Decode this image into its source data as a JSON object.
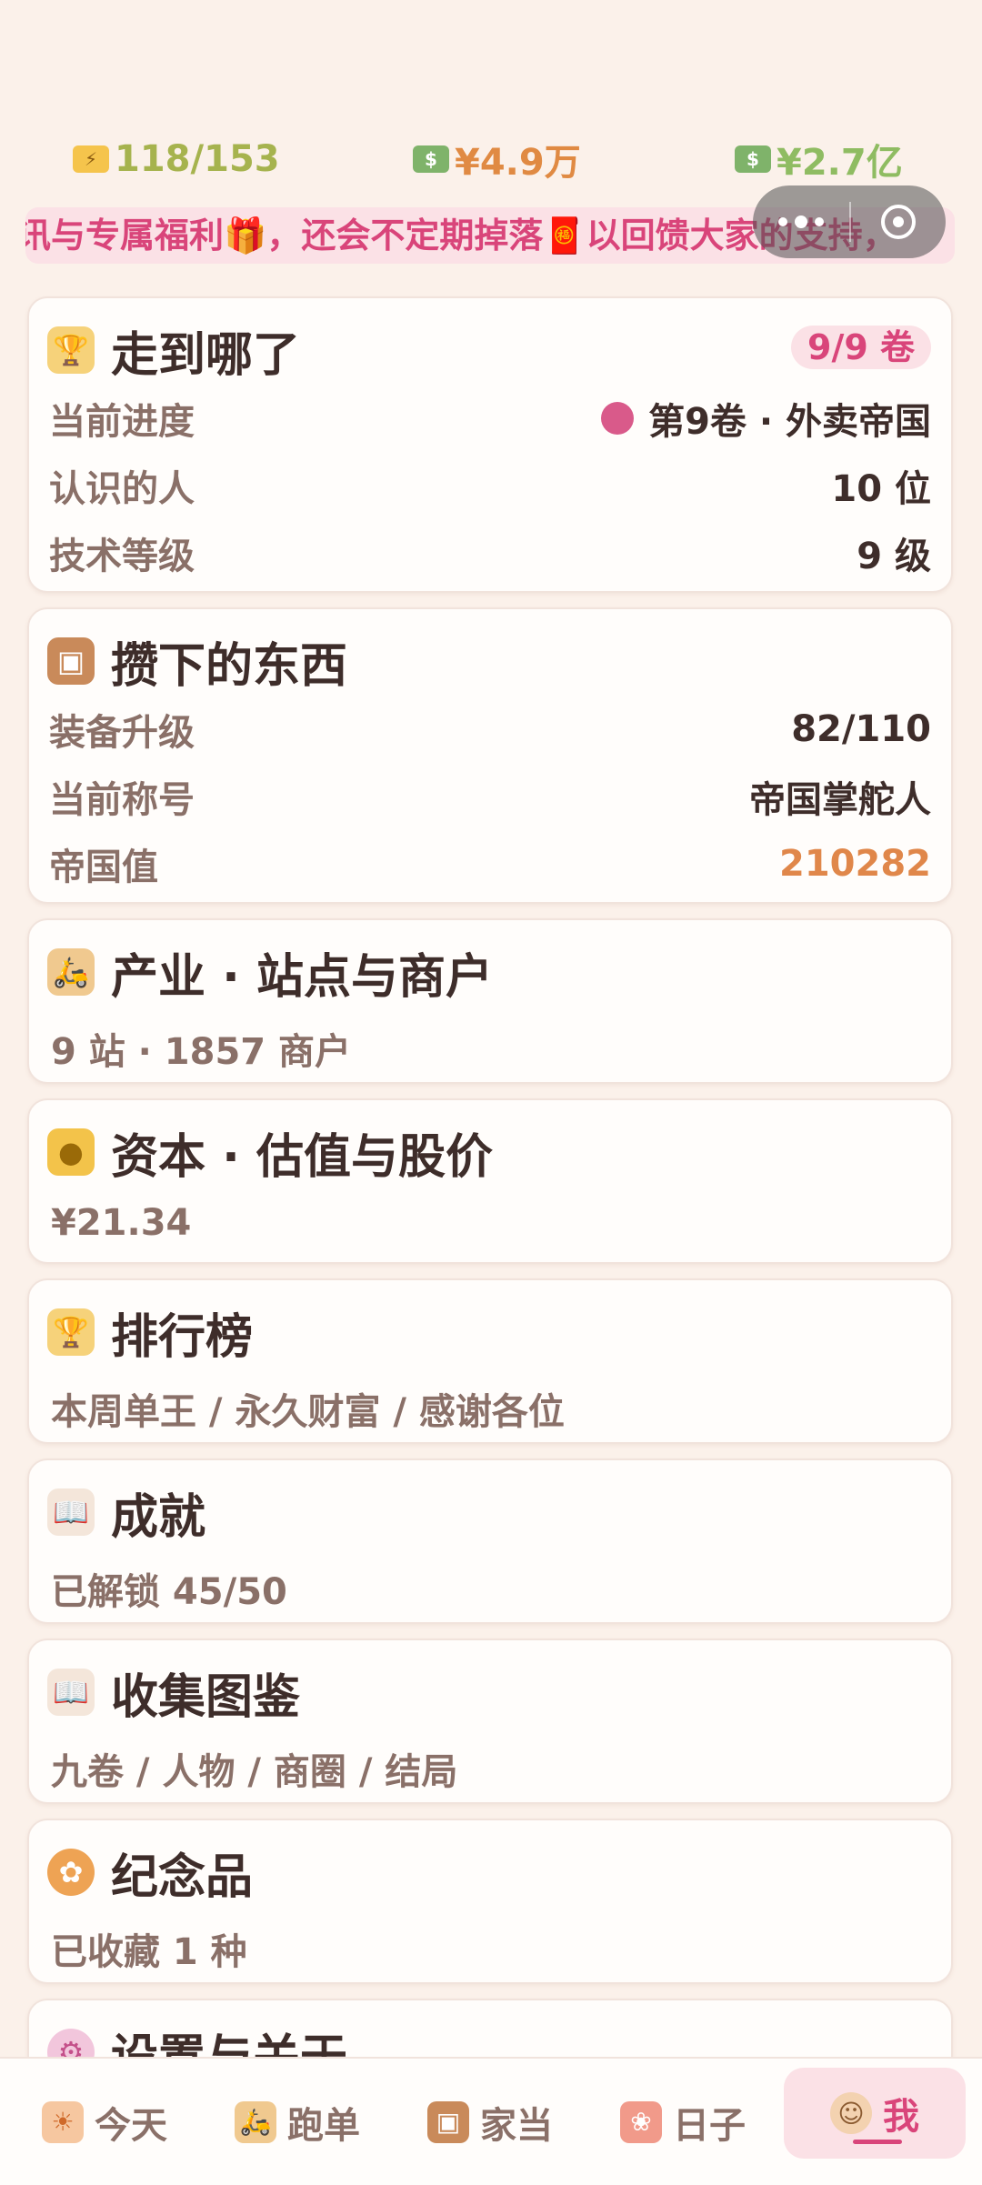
{
  "stats": {
    "energy": "118/153",
    "energy_icon": "ticket-icon",
    "cash": "¥4.9万",
    "cash_icon": "money-icon",
    "assets": "¥2.7亿",
    "assets_icon": "money-stack-icon"
  },
  "marquee": {
    "text": "讯与专属福利🎁，还会不定期掉落🧧以回馈大家的支持，"
  },
  "progress_card": {
    "title": "走到哪了",
    "icon": "trophy-icon",
    "badge": "9/9 卷",
    "rows": [
      {
        "label": "当前进度",
        "value": "第9卷 · 外卖帝国"
      },
      {
        "label": "认识的人",
        "value": "10 位"
      },
      {
        "label": "技术等级",
        "value": "9 级"
      }
    ]
  },
  "savings_card": {
    "title": "攒下的东西",
    "icon": "treasure-chest-icon",
    "rows": [
      {
        "label": "装备升级",
        "value": "82/110"
      },
      {
        "label": "当前称号",
        "value": "帝国掌舵人"
      },
      {
        "label": "帝国值",
        "value": "210282"
      }
    ]
  },
  "menu_cards": [
    {
      "title": "产业 · 站点与商户",
      "subtitle": "9 站 · 1857 商户",
      "icon": "scooter-icon"
    },
    {
      "title": "资本 · 估值与股价",
      "subtitle": "¥21.34",
      "icon": "coins-icon"
    },
    {
      "title": "排行榜",
      "subtitle": "本周单王 / 永久财富 / 感谢各位",
      "icon": "trophy-icon"
    },
    {
      "title": "成就",
      "subtitle": "已解锁 45/50",
      "icon": "open-book-icon"
    },
    {
      "title": "收集图鉴",
      "subtitle": "九卷 / 人物 / 商圈 / 结局",
      "icon": "open-book-icon"
    },
    {
      "title": "纪念品",
      "subtitle": "已收藏 1 种",
      "icon": "mooncake-icon"
    },
    {
      "title": "设置与关于",
      "subtitle": "",
      "icon": "gear-icon"
    }
  ],
  "tabs": [
    {
      "label": "今天",
      "icon": "sun-calendar-icon"
    },
    {
      "label": "跑单",
      "icon": "scooter-icon"
    },
    {
      "label": "家当",
      "icon": "treasure-chest-icon"
    },
    {
      "label": "日子",
      "icon": "cookbook-icon"
    },
    {
      "label": "我",
      "icon": "avatar-icon",
      "active": true
    }
  ]
}
